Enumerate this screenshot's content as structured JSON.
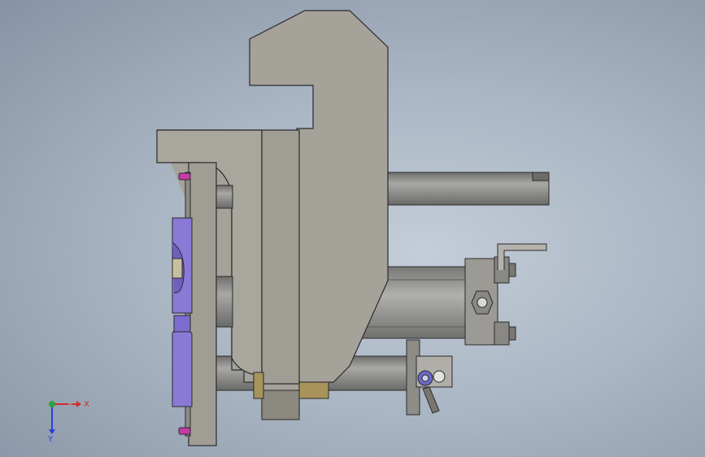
{
  "triad": {
    "x_label": "X",
    "y_label": "Y",
    "x_color": "#d42a2a",
    "y_color": "#2a3fd4",
    "origin_color": "#2fa23a"
  },
  "colors": {
    "background": "#aab6c4",
    "casting": "#a5a29a",
    "casting_edge": "#2b2b2b",
    "rod": "#8c8c8a",
    "pad_purple": "#8a7ad6",
    "pin_magenta": "#c83aa8",
    "bronze": "#a8935a"
  }
}
